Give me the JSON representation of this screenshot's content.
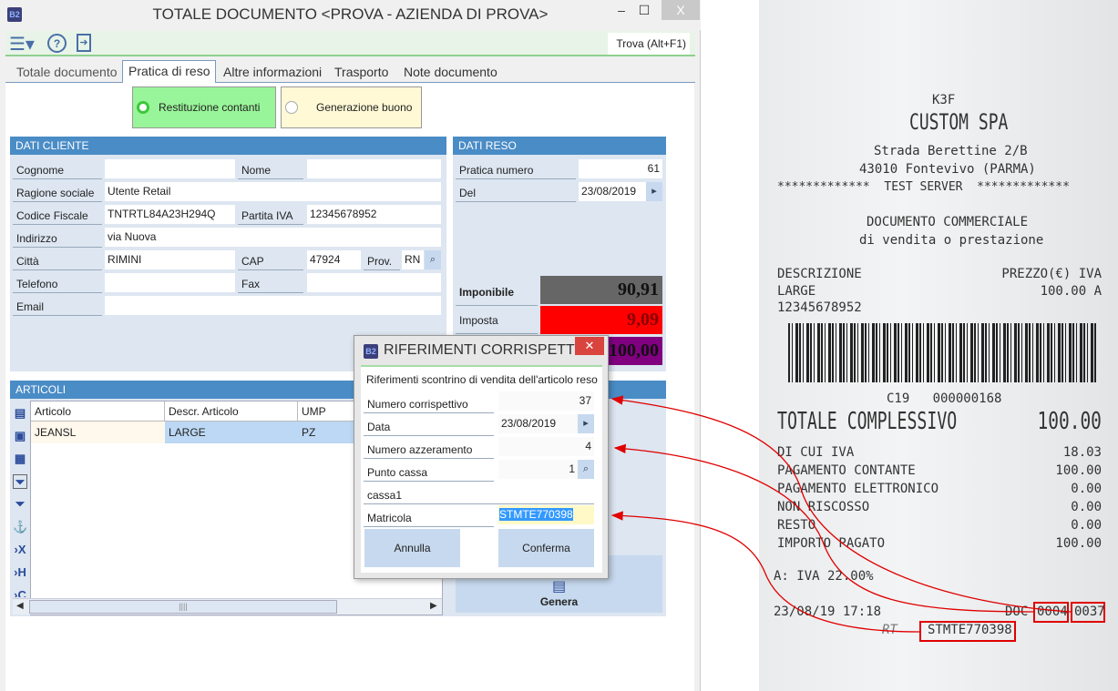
{
  "window": {
    "title": "TOTALE DOCUMENTO <PROVA - AZIENDA DI PROVA>",
    "logo": "B2",
    "minimize": "–",
    "maximize": "☐",
    "close": "X"
  },
  "toolbar": {
    "icons": [
      "menu-icon",
      "help-icon",
      "exit-icon"
    ],
    "find": "Trova (Alt+F1)"
  },
  "tabs": [
    "Totale documento",
    "Pratica di reso",
    "Altre informazioni",
    "Trasporto",
    "Note documento"
  ],
  "return_mode": {
    "cash": "Restituzione contanti",
    "voucher": "Generazione buono",
    "selected": "cash"
  },
  "customer": {
    "title": "DATI CLIENTE",
    "cognome_label": "Cognome",
    "cognome": "",
    "nome_label": "Nome",
    "nome": "",
    "ragione_label": "Ragione sociale",
    "ragione": "Utente Retail",
    "cf_label": "Codice Fiscale",
    "cf": "TNTRTL84A23H294Q",
    "piva_label": "Partita IVA",
    "piva": "12345678952",
    "indirizzo_label": "Indirizzo",
    "indirizzo": "via Nuova",
    "citta_label": "Città",
    "citta": "RIMINI",
    "cap_label": "CAP",
    "cap": "47924",
    "prov_label": "Prov.",
    "prov": "RN",
    "telefono_label": "Telefono",
    "telefono": "",
    "fax_label": "Fax",
    "fax": "",
    "email_label": "Email",
    "email": ""
  },
  "reso": {
    "title": "DATI RESO",
    "pratica_label": "Pratica numero",
    "pratica": "61",
    "del_label": "Del",
    "del": "23/08/2019",
    "imponibile_label": "Imponibile",
    "imponibile": "90,91",
    "imposta_label": "Imposta",
    "imposta": "9,09",
    "totale": "100,00",
    "colors": {
      "imponibile": "#666666",
      "imposta": "#ff0000",
      "totale": "#800080"
    }
  },
  "articoli": {
    "title": "ARTICOLI",
    "columns": [
      "Articolo",
      "Descr. Articolo",
      "UMP"
    ],
    "rows": [
      [
        "JEANSL",
        "LARGE",
        "PZ"
      ]
    ],
    "genera": "Genera"
  },
  "dialog": {
    "title": "RIFERIMENTI CORRISPETTIV...",
    "subtitle": "Riferimenti scontrino di vendita dell'articolo reso",
    "numero_label": "Numero corrispettivo",
    "numero": "37",
    "data_label": "Data",
    "data": "23/08/2019",
    "azzeramento_label": "Numero azzeramento",
    "azzeramento": "4",
    "cassa_label": "Punto cassa",
    "cassa": "1",
    "cassa_name": "cassa1",
    "matricola_label": "Matricola",
    "matricola": "STMTE770398",
    "cancel": "Annulla",
    "confirm": "Conferma"
  },
  "receipt": {
    "model": "K3F",
    "company": "CUSTOM SPA",
    "address1": "Strada Berettine 2/B",
    "address2": "43010 Fontevivo (PARMA)",
    "test": "*************  TEST SERVER  *************",
    "doc1": "DOCUMENTO COMMERCIALE",
    "doc2": "di vendita o prestazione",
    "col_desc": "DESCRIZIONE",
    "col_price": "PREZZO(€) IVA",
    "item": "LARGE",
    "item_price": "100.00 A",
    "item_code": "12345678952",
    "barcode_text": "C19   000000168",
    "total_label": "TOTALE COMPLESSIVO",
    "total": "100.00",
    "lines": [
      [
        "DI CUI IVA",
        "18.03"
      ],
      [
        "PAGAMENTO CONTANTE",
        "100.00"
      ],
      [
        "PAGAMENTO ELETTRONICO",
        "0.00"
      ],
      [
        "NON RISCOSSO",
        "0.00"
      ],
      [
        "RESTO",
        "0.00"
      ],
      [
        "IMPORTO PAGATO",
        "100.00"
      ]
    ],
    "vat": "A: IVA 22.00%",
    "datetime": "23/08/19 17:18",
    "doc_label": "DOC",
    "z_number": "0004",
    "doc_number": "0037",
    "rt": "RT",
    "serial": "STMTE770398"
  },
  "annotation_color": "#e00000"
}
